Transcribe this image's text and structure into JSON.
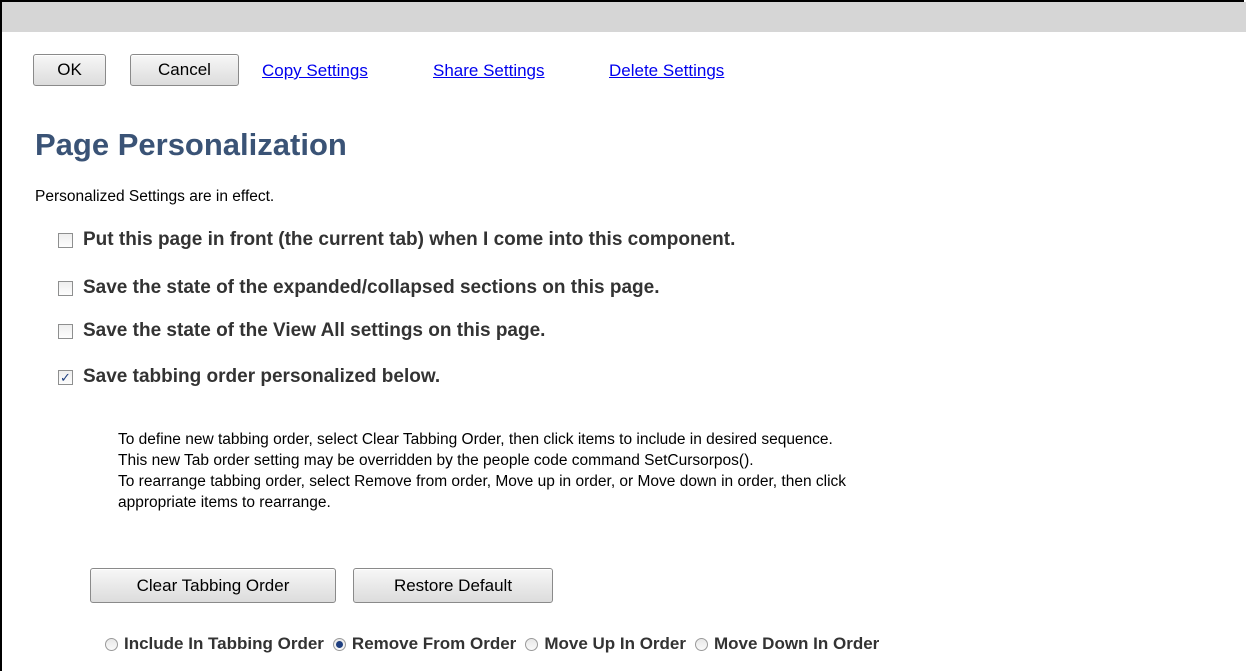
{
  "toolbar": {
    "ok_label": "OK",
    "cancel_label": "Cancel",
    "links": [
      "Copy Settings",
      "Share Settings",
      "Delete Settings"
    ]
  },
  "page": {
    "title": "Page Personalization",
    "status": "Personalized Settings are in effect."
  },
  "options": [
    {
      "label": "Put this page in front (the current tab) when I come into this component.",
      "checked": false
    },
    {
      "label": "Save the state of the expanded/collapsed sections on this page.",
      "checked": false
    },
    {
      "label": "Save the state of the View All settings on this page.",
      "checked": false
    },
    {
      "label": "Save tabbing order personalized below.",
      "checked": true
    }
  ],
  "instructions": [
    "To define new tabbing order, select Clear Tabbing Order, then click items to include in desired sequence.",
    "This new Tab order setting may be overridden by the people code command SetCursorpos().",
    "To rearrange tabbing order, select Remove from order, Move up in order, or Move down in order, then click",
    "appropriate items to rearrange."
  ],
  "tabbing_buttons": {
    "clear_label": "Clear Tabbing Order",
    "restore_label": "Restore Default"
  },
  "tabbing_modes": {
    "options": [
      "Include In Tabbing Order",
      "Remove From Order",
      "Move Up In Order",
      "Move Down In Order"
    ],
    "selected": "Remove From Order"
  }
}
